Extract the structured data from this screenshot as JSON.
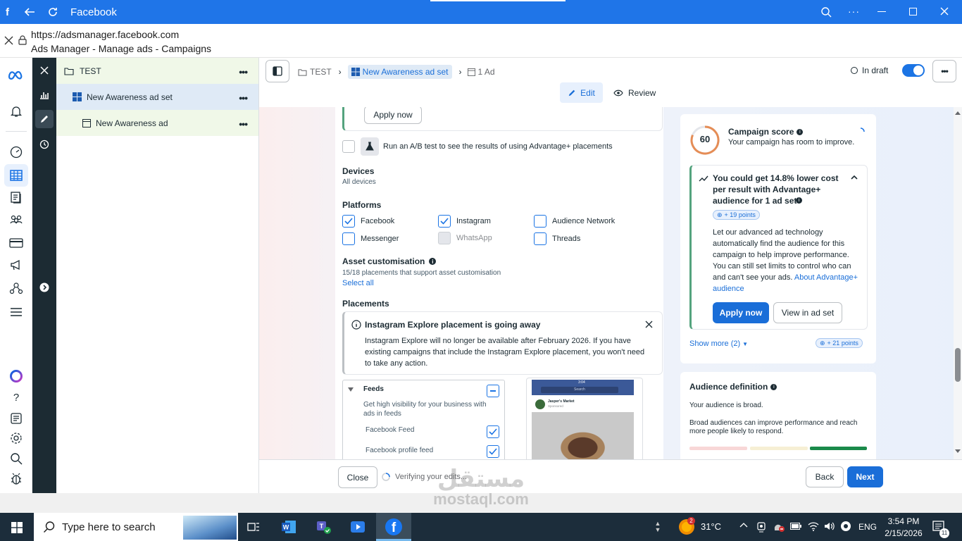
{
  "browser": {
    "title": "Facebook",
    "url": "https://adsmanager.facebook.com",
    "page_title": "Ads Manager - Manage ads - Campaigns"
  },
  "tree": {
    "campaign": "TEST",
    "adset": "New Awareness ad set",
    "ad": "New Awareness ad"
  },
  "topbar": {
    "crumb_campaign": "TEST",
    "crumb_adset": "New Awareness ad set",
    "crumb_ad": "1 Ad",
    "status": "In draft",
    "edit_label": "Edit",
    "review_label": "Review"
  },
  "form": {
    "apply_now": "Apply now",
    "ab_test": "Run an A/B test to see the results of using Advantage+ placements",
    "devices_title": "Devices",
    "devices_value": "All devices",
    "platforms_title": "Platforms",
    "platforms": [
      {
        "label": "Facebook",
        "checked": true
      },
      {
        "label": "Instagram",
        "checked": true
      },
      {
        "label": "Audience Network",
        "checked": false
      },
      {
        "label": "Messenger",
        "checked": false
      },
      {
        "label": "WhatsApp",
        "checked": false,
        "disabled": true
      },
      {
        "label": "Threads",
        "checked": false
      }
    ],
    "asset_title": "Asset customisation",
    "asset_sub": "15/18 placements that support asset customisation",
    "select_all": "Select all",
    "placements_title": "Placements",
    "notice_title": "Instagram Explore placement is going away",
    "notice_body": "Instagram Explore will no longer be available after February 2026. If you have existing campaigns that include the Instagram Explore placement, you won't need to take any action.",
    "feeds_title": "Feeds",
    "feeds_desc": "Get high visibility for your business with ads in feeds",
    "feeds_items": [
      "Facebook Feed",
      "Facebook profile feed"
    ],
    "preview_time": "3:04",
    "preview_search": "Search",
    "preview_page": "Jasper's Market",
    "preview_sponsored": "Sponsored"
  },
  "score": {
    "value": "60",
    "title": "Campaign score",
    "subtitle": "Your campaign has room to improve.",
    "rec_title": "You could get 14.8% lower cost per result with Advantage+ audience for 1 ad set",
    "rec_points": "+ 19 points",
    "rec_body": "Let our advanced ad technology automatically find the audience for this campaign to help improve performance. You can still set limits to control who can and can't see your ads.",
    "rec_link": "About Advantage+ audience",
    "apply_now": "Apply now",
    "view_in_adset": "View in ad set",
    "show_more": "Show more (2)",
    "more_points": "+ 21 points"
  },
  "audience": {
    "title": "Audience definition",
    "line1": "Your audience is broad.",
    "line2": "Broad audiences can improve performance and reach more people likely to respond."
  },
  "bottom": {
    "close": "Close",
    "verifying": "Verifying your edits...",
    "back": "Back",
    "next": "Next"
  },
  "taskbar": {
    "search_placeholder": "Type here to search",
    "weather": "31°C",
    "lang": "ENG",
    "time": "3:54 PM",
    "date": "2/15/2026",
    "notif_count": "11",
    "weather_badge": "2"
  },
  "watermark": {
    "arabic": "مستقل",
    "latin": "mostaql.com"
  },
  "colors": {
    "brand": "#1b74e4",
    "browser": "#1f75e8",
    "dark_rail": "#1c2b33",
    "taskbar": "#1c2d3b"
  }
}
